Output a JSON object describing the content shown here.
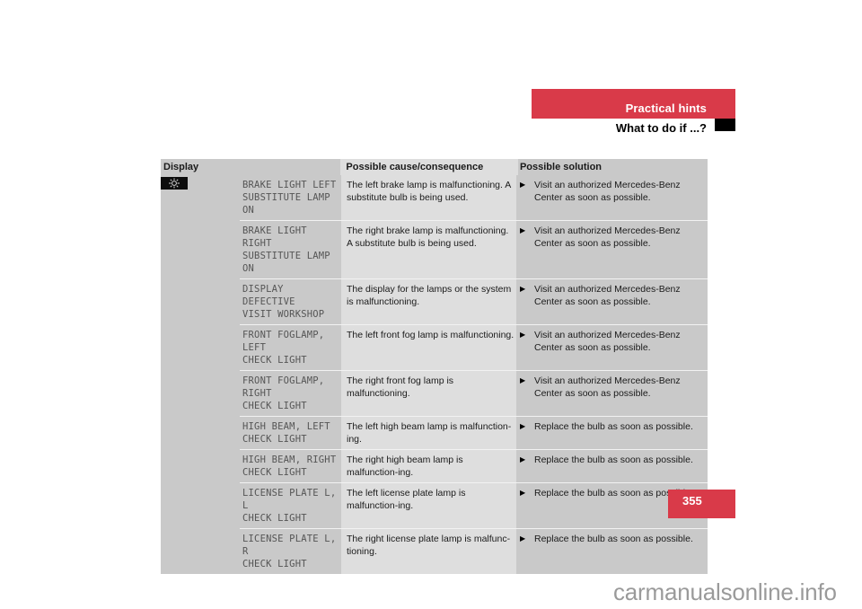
{
  "header": {
    "section_title": "Practical hints",
    "subsection_title": "What to do if ...?",
    "accent_color": "#d93a49"
  },
  "table": {
    "columns": [
      "Display",
      "Possible cause/consequence",
      "Possible solution"
    ],
    "group_icon": "exterior-lamp-icon",
    "rows": [
      {
        "display": [
          "BRAKE LIGHT LEFT",
          "SUBSTITUTE LAMP ON"
        ],
        "cause": "The left brake lamp is malfunctioning. A substitute bulb is being used.",
        "solution": "Visit an authorized Mercedes-Benz Center as soon as possible."
      },
      {
        "display": [
          "BRAKE LIGHT RIGHT",
          "SUBSTITUTE LAMP ON"
        ],
        "cause": "The right brake lamp is malfunctioning. A substitute bulb is being used.",
        "solution": "Visit an authorized Mercedes-Benz Center as soon as possible."
      },
      {
        "display": [
          "DISPLAY DEFECTIVE",
          "VISIT WORKSHOP"
        ],
        "cause": "The display for the lamps or the system is malfunctioning.",
        "solution": "Visit an authorized Mercedes-Benz Center as soon as possible."
      },
      {
        "display": [
          "FRONT FOGLAMP, LEFT",
          "CHECK LIGHT"
        ],
        "cause": "The left front fog lamp is malfunctioning.",
        "solution": "Visit an authorized Mercedes-Benz Center as soon as possible."
      },
      {
        "display": [
          "FRONT FOGLAMP, RIGHT",
          "CHECK LIGHT"
        ],
        "cause": "The right front fog lamp is malfunctioning.",
        "solution": "Visit an authorized Mercedes-Benz Center as soon as possible."
      },
      {
        "display": [
          "HIGH BEAM, LEFT",
          "CHECK LIGHT"
        ],
        "cause": "The left high beam lamp is malfunction-ing.",
        "solution": "Replace the bulb as soon as possible."
      },
      {
        "display": [
          "HIGH BEAM, RIGHT",
          "CHECK LIGHT"
        ],
        "cause": "The right high beam lamp is malfunction-ing.",
        "solution": "Replace the bulb as soon as possible."
      },
      {
        "display": [
          "LICENSE PLATE L, L",
          "CHECK LIGHT"
        ],
        "cause": "The left license plate lamp is malfunction-ing.",
        "solution": "Replace the bulb as soon as possible."
      },
      {
        "display": [
          "LICENSE PLATE L, R",
          "CHECK LIGHT"
        ],
        "cause": "The right license plate lamp is malfunc-tioning.",
        "solution": "Replace the bulb as soon as possible."
      }
    ],
    "bullet_glyph": "▶"
  },
  "page_number": "355",
  "watermark": "carmanualsonline.info"
}
